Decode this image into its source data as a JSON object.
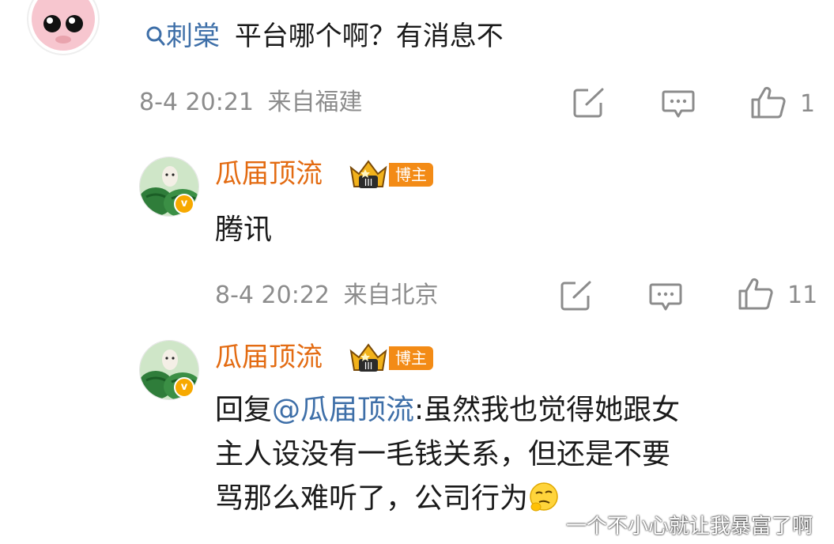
{
  "comment": {
    "search_prefix": "刺棠",
    "text": "平台哪个啊？有消息不",
    "time": "8-4 20:21",
    "location": "来自福建",
    "like_count": "1"
  },
  "replies": [
    {
      "username": "瓜届顶流",
      "badge": "博主",
      "crown_level": "III",
      "verified_mark": "v",
      "text": "腾讯",
      "time": "8-4 20:22",
      "location": "来自北京",
      "like_count": "11"
    },
    {
      "username": "瓜届顶流",
      "badge": "博主",
      "crown_level": "III",
      "verified_mark": "v",
      "reply_prefix": "回复",
      "mention": "@瓜届顶流",
      "text_line1": ":虽然我也觉得她跟女",
      "text_line2": "主人设没有一毛钱关系，但还是不要",
      "text_line3": "骂那么难听了，公司行为"
    }
  ],
  "watermark": "一个不小心就让我暴富了啊",
  "colors": {
    "link": "#3e6fa8",
    "username": "#e36b12",
    "badge_bg": "#f38b16",
    "meta_gray": "#8c8c8c",
    "verified": "#f7a900"
  },
  "icons": [
    "search-icon",
    "share-icon",
    "comment-icon",
    "like-icon",
    "crown-icon",
    "verified-icon",
    "thinking-emoji-icon"
  ]
}
